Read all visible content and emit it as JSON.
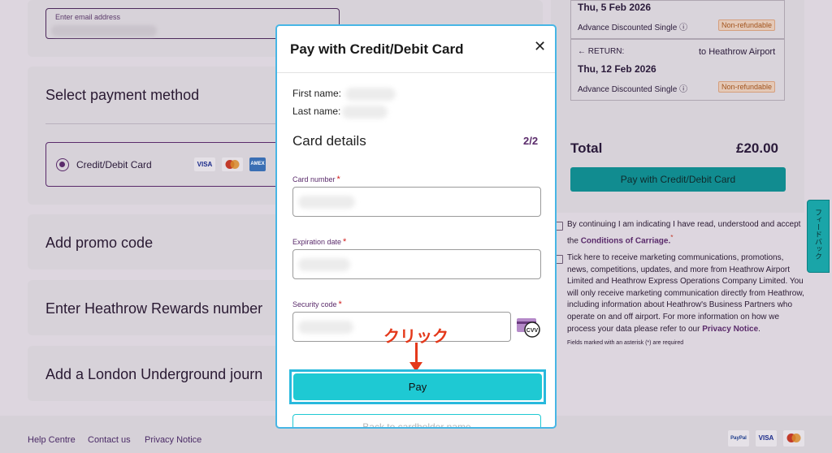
{
  "form": {
    "email_label": "Enter email address",
    "payment_section_title": "Select payment method",
    "payment_option_label": "Credit/Debit Card",
    "payment_logos": [
      "VISA",
      "",
      "AMEX"
    ],
    "promo_title": "Add promo code",
    "rewards_title": "Enter Heathrow Rewards number",
    "underground_title": "Add a London Underground journ"
  },
  "summary": {
    "outbound_date": "Thu, 5 Feb 2026",
    "outbound_ticket": "Advance Discounted Single ⓘ",
    "outbound_badge": "Non-refundable",
    "return_label": "← RETURN:",
    "return_destination": "to Heathrow Airport",
    "return_date": "Thu, 12 Feb 2026",
    "return_ticket": "Advance Discounted Single ⓘ",
    "return_badge": "Non-refundable",
    "total_label": "Total",
    "total_value": "£20.00",
    "pay_button": "Pay with Credit/Debit Card",
    "terms_text": "By continuing I am indicating I have read, understood and accept the",
    "terms_link": "Conditions of Carriage.",
    "terms_asterisk": "*",
    "marketing_text": "Tick here to receive marketing communications, promotions, news, competitions, updates, and more from Heathrow Airport Limited and Heathrow Express Operations Company Limited. You will only receive marketing communication directly from Heathrow, including information about Heathrow's Business Partners who operate on and off airport.",
    "privacy_text": "For more information on how we process your data please refer to our",
    "privacy_link": "Privacy Notice",
    "privacy_end": ".",
    "required_note": "Fields marked with an asterisk (*) are required"
  },
  "feedback_tab": "フィードバック",
  "footer": {
    "links": [
      "Help Centre",
      "Contact us",
      "Privacy Notice"
    ],
    "logos": [
      "PayPal",
      "VISA",
      ""
    ]
  },
  "modal": {
    "title": "Pay with Credit/Debit Card",
    "close": "✕",
    "first_name_label": "First name:",
    "last_name_label": "Last name:",
    "section_title": "Card details",
    "step": "2/2",
    "card_number_label": "Card number",
    "expiration_label": "Expiration date",
    "security_label": "Security code",
    "required_mark": "*",
    "cvv_icon_text": "CVV",
    "pay_button": "Pay",
    "back_button": "Back to cardholder name"
  },
  "annotation": {
    "text": "クリック",
    "color": "#e4391b"
  },
  "colors": {
    "accent_teal": "#1ec9d3",
    "brand_purple": "#5a2b6b",
    "highlight_blue": "#28b9dd"
  }
}
